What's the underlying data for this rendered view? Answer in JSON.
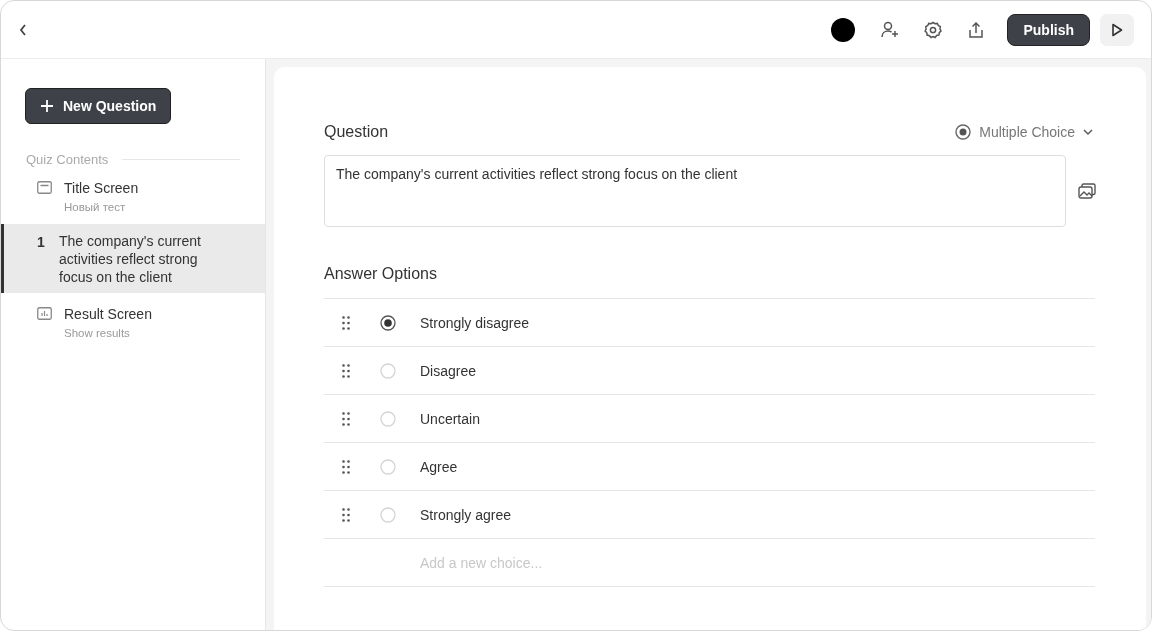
{
  "header": {
    "publish_label": "Publish"
  },
  "sidebar": {
    "new_button": "New Question",
    "section_title": "Quiz Contents",
    "items": [
      {
        "kind": "title",
        "title": "Title Screen",
        "subtitle": "Новый тест",
        "selected": false
      },
      {
        "kind": "question",
        "number": "1",
        "title": "The company's current activities reflect strong focus on the client",
        "selected": true
      },
      {
        "kind": "result",
        "title": "Result Screen",
        "subtitle": "Show results",
        "selected": false
      }
    ]
  },
  "question": {
    "label": "Question",
    "type_label": "Multiple Choice",
    "text": "The company's current activities reflect strong focus on the client"
  },
  "answers": {
    "label": "Answer Options",
    "options": [
      {
        "label": "Strongly disagree",
        "selected": true
      },
      {
        "label": "Disagree",
        "selected": false
      },
      {
        "label": "Uncertain",
        "selected": false
      },
      {
        "label": "Agree",
        "selected": false
      },
      {
        "label": "Strongly agree",
        "selected": false
      }
    ],
    "new_placeholder": "Add a new choice..."
  }
}
